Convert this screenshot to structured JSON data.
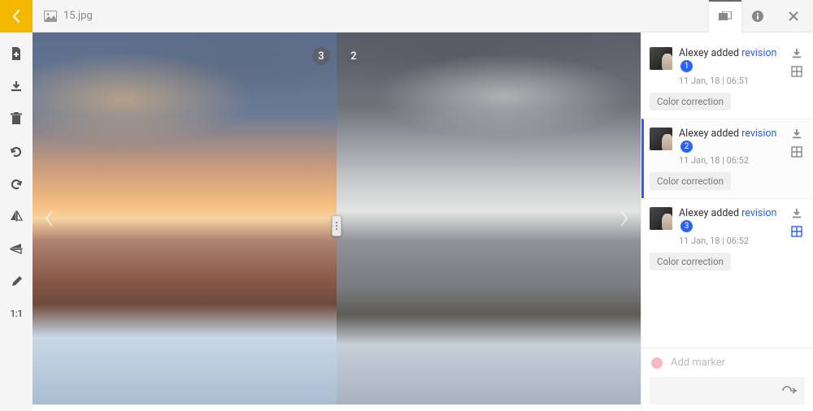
{
  "header": {
    "filename": "15.jpg"
  },
  "compare": {
    "left_label": "3",
    "right_label": "2"
  },
  "toolbar": {
    "ratio_label": "1:1"
  },
  "revisions": [
    {
      "user": "Alexey",
      "action": "added",
      "link_text": "revision",
      "number": "1",
      "timestamp": "11 Jan, 18 | 06:51",
      "tag": "Color correction",
      "selected": false,
      "grid_highlight": false
    },
    {
      "user": "Alexey",
      "action": "added",
      "link_text": "revision",
      "number": "2",
      "timestamp": "11 Jan, 18 | 06:52",
      "tag": "Color correction",
      "selected": true,
      "grid_highlight": false
    },
    {
      "user": "Alexey",
      "action": "added",
      "link_text": "revision",
      "number": "3",
      "timestamp": "11 Jan, 18 | 06:52",
      "tag": "Color correction",
      "selected": false,
      "grid_highlight": true
    }
  ],
  "marker": {
    "placeholder": "Add marker"
  }
}
